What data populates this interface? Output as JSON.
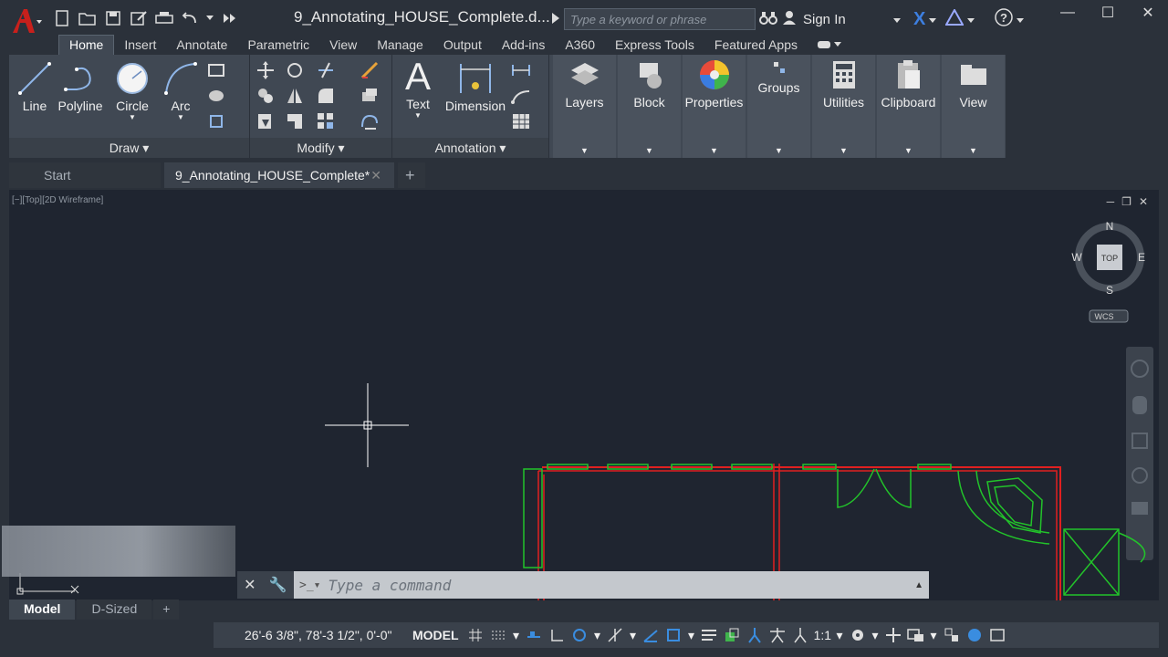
{
  "titlebar": {
    "doc_title": "9_Annotating_HOUSE_Complete.d...",
    "search_placeholder": "Type a keyword or phrase",
    "sign_in": "Sign In"
  },
  "ribbon_tabs": [
    "Home",
    "Insert",
    "Annotate",
    "Parametric",
    "View",
    "Manage",
    "Output",
    "Add-ins",
    "A360",
    "Express Tools",
    "Featured Apps"
  ],
  "ribbon": {
    "draw": {
      "label": "Draw",
      "tools": [
        "Line",
        "Polyline",
        "Circle",
        "Arc"
      ]
    },
    "modify": {
      "label": "Modify"
    },
    "annotation": {
      "label": "Annotation",
      "tools": [
        "Text",
        "Dimension"
      ]
    },
    "groups": [
      "Layers",
      "Block",
      "Properties",
      "Groups",
      "Utilities",
      "Clipboard",
      "View"
    ]
  },
  "doc_tabs": {
    "start": "Start",
    "active": "9_Annotating_HOUSE_Complete*"
  },
  "viewport": {
    "label": "[−][Top][2D Wireframe]",
    "compass": {
      "n": "N",
      "s": "S",
      "e": "E",
      "w": "W",
      "top": "TOP",
      "wcs": "WCS"
    }
  },
  "command": {
    "placeholder": "Type a command"
  },
  "layout_tabs": [
    "Model",
    "D-Sized"
  ],
  "status": {
    "coords": "26'-6 3/8\", 78'-3 1/2\", 0'-0\"",
    "space": "MODEL",
    "scale": "1:1"
  },
  "colors": {
    "wall": "#e02020",
    "window": "#22c42a",
    "canvas": "#1f2530"
  }
}
